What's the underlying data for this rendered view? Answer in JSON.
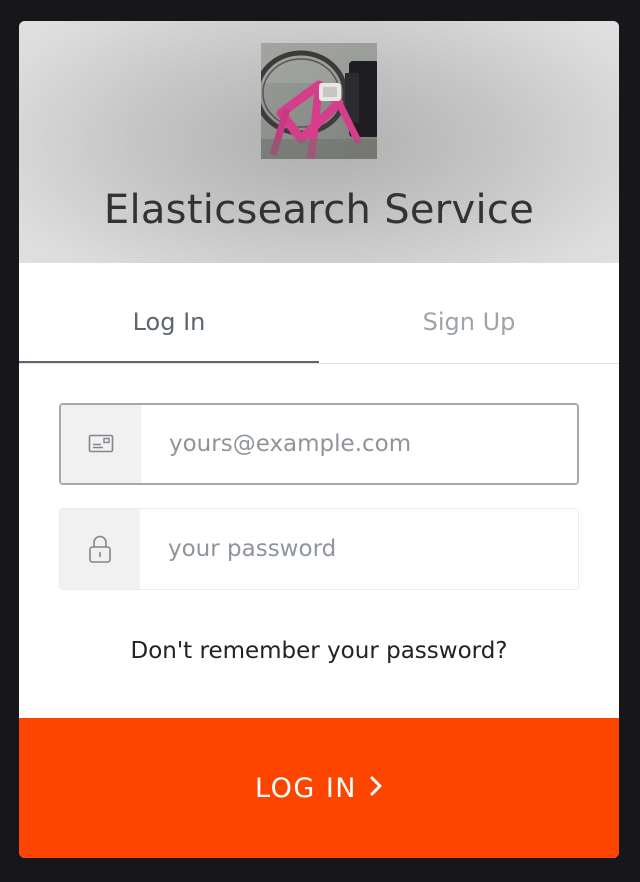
{
  "header": {
    "title": "Elasticsearch Service",
    "logo_icon": "bicycle-photo-logo"
  },
  "tabs": [
    {
      "label": "Log In",
      "active": true
    },
    {
      "label": "Sign Up",
      "active": false
    }
  ],
  "email": {
    "icon": "email-card-icon",
    "placeholder": "yours@example.com",
    "value": ""
  },
  "password": {
    "icon": "lock-icon",
    "placeholder": "your password",
    "value": ""
  },
  "forgot_link": "Don't remember your password?",
  "submit": {
    "label": "LOG IN",
    "icon": "chevron-right-icon"
  },
  "colors": {
    "accent": "#fe4500",
    "active_tab": "#5c666f",
    "inactive_tab": "#9ea3a8",
    "backdrop": "#17171b"
  }
}
